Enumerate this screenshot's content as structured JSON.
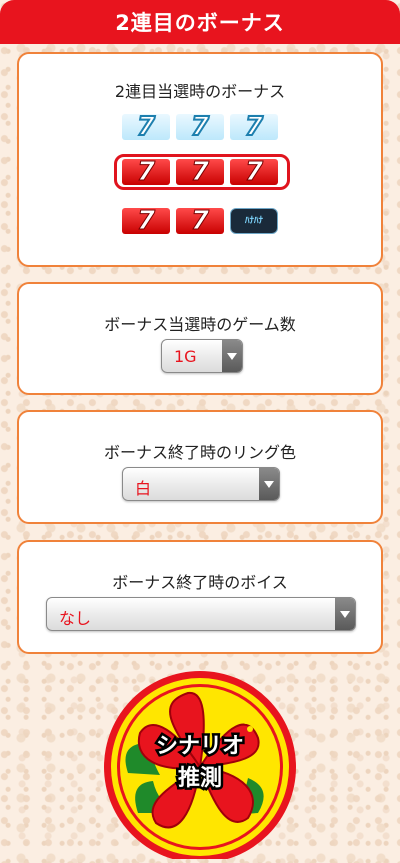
{
  "header": {
    "title": "2連目のボーナス"
  },
  "bonus_card": {
    "title": "2連目当選時のボーナス",
    "rows": [
      {
        "symbols": [
          "blue-7",
          "blue-7",
          "blue-7"
        ],
        "selected": false
      },
      {
        "symbols": [
          "red-7",
          "red-7",
          "red-7"
        ],
        "selected": true
      },
      {
        "symbols": [
          "red-7",
          "red-7",
          "hana-hana-logo"
        ],
        "selected": false
      }
    ],
    "seven_glyph": "7",
    "logo_text": "ﾊﾅﾊﾅ"
  },
  "game_count_card": {
    "title": "ボーナス当選時のゲーム数",
    "select_value": "1G"
  },
  "ring_color_card": {
    "title": "ボーナス終了時のリング色",
    "select_value": "白"
  },
  "voice_card": {
    "title": "ボーナス終了時のボイス",
    "select_value": "なし"
  },
  "scenario_button": {
    "line1": "シナリオ",
    "line2": "推測"
  },
  "colors": {
    "accent_red": "#e8141e",
    "card_border": "#f0823a",
    "select_text_red": "#e8141e",
    "badge_yellow": "#ffe600"
  }
}
